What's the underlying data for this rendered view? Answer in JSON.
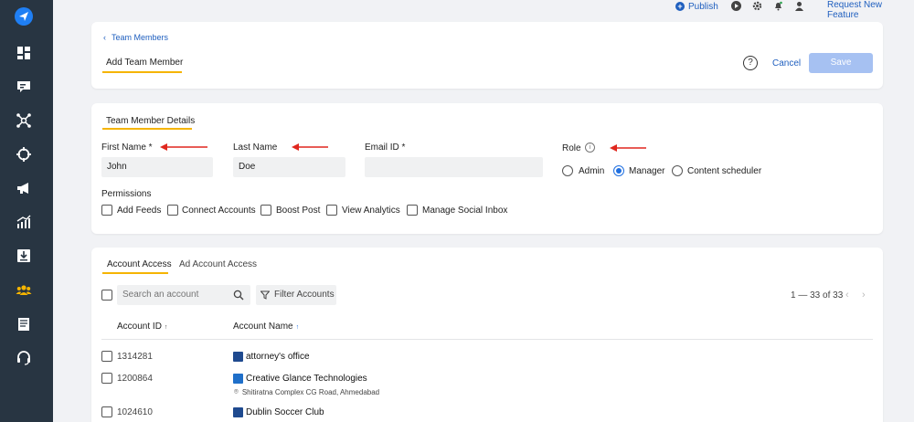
{
  "topbar": {
    "publish_label": "Publish",
    "request_label": "Request New Feature"
  },
  "header": {
    "breadcrumb": "Team Members",
    "title": "Add Team Member",
    "help_symbol": "?",
    "cancel_label": "Cancel",
    "save_label": "Save"
  },
  "details": {
    "section_title": "Team Member Details",
    "first_name": {
      "label": "First Name *",
      "value": "John"
    },
    "last_name": {
      "label": "Last Name",
      "value": "Doe"
    },
    "email": {
      "label": "Email ID *",
      "value": ""
    },
    "role": {
      "label": "Role",
      "info_symbol": "i",
      "options": [
        "Admin",
        "Manager",
        "Content scheduler"
      ],
      "selected": "Manager"
    },
    "permissions": {
      "label": "Permissions",
      "items": [
        "Add Feeds",
        "Connect Accounts",
        "Boost Post",
        "View Analytics",
        "Manage Social Inbox"
      ]
    }
  },
  "access": {
    "tabs": [
      "Account Access",
      "Ad Account Access"
    ],
    "search_placeholder": "Search an account",
    "filter_label": "Filter Accounts",
    "pagination": "1 — 33 of 33",
    "columns": [
      "Account ID",
      "Account Name"
    ],
    "rows": [
      {
        "id": "1314281",
        "name": "attorney's office",
        "location": ""
      },
      {
        "id": "1200864",
        "name": "Creative Glance Technologies",
        "location": "Shitiratna Complex CG Road, Ahmedabad"
      },
      {
        "id": "1024610",
        "name": "Dublin Soccer Club",
        "location": ""
      }
    ]
  },
  "colors": {
    "sidebar_bg": "#283542",
    "brand_blue": "#1f5fbf",
    "accent_yellow": "#f5b400",
    "save_disabled": "#a6c1f2",
    "annotation_red": "#e0271e"
  },
  "icons": {
    "sidebar": [
      "logo-icon",
      "dashboard-icon",
      "inbox-icon",
      "network-icon",
      "target-icon",
      "megaphone-icon",
      "analytics-icon",
      "download-icon",
      "team-icon",
      "report-icon",
      "support-icon"
    ],
    "topbar": [
      "publish-plus-icon",
      "play-icon",
      "gear-icon",
      "bell-icon",
      "user-icon"
    ]
  }
}
